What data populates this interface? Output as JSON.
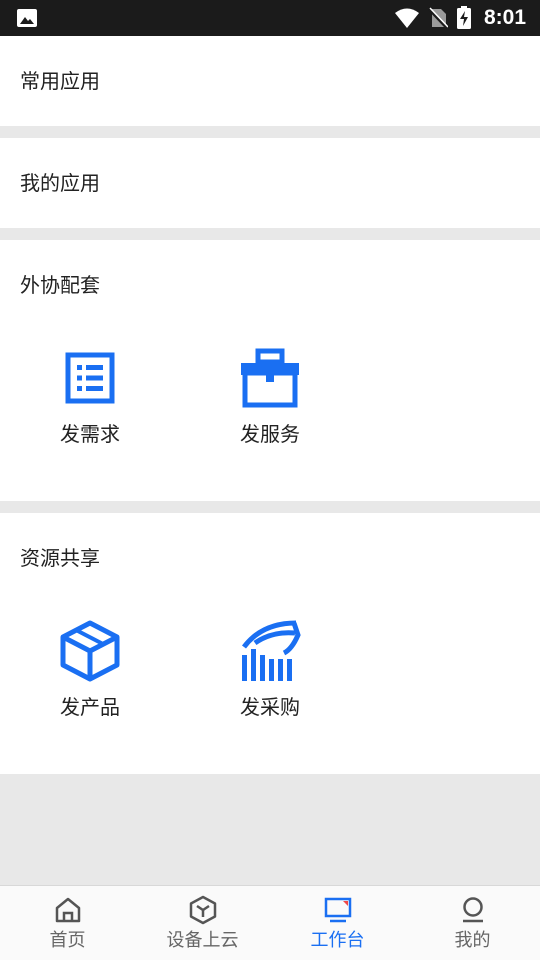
{
  "status_bar": {
    "time": "8:01",
    "icons": [
      "image-icon",
      "wifi-icon",
      "no-sim-icon",
      "battery-charging-icon"
    ]
  },
  "sections": {
    "common_apps": {
      "title": "常用应用"
    },
    "my_apps": {
      "title": "我的应用"
    },
    "outsourcing": {
      "title": "外协配套",
      "items": [
        {
          "label": "发需求",
          "icon": "list-document-icon"
        },
        {
          "label": "发服务",
          "icon": "toolbox-icon"
        }
      ]
    },
    "resource_sharing": {
      "title": "资源共享",
      "items": [
        {
          "label": "发产品",
          "icon": "box-cube-icon"
        },
        {
          "label": "发采购",
          "icon": "purchase-chart-icon"
        }
      ]
    }
  },
  "tabbar": {
    "items": [
      {
        "label": "首页",
        "icon": "home-icon",
        "active": false
      },
      {
        "label": "设备上云",
        "icon": "cube-cloud-icon",
        "active": false
      },
      {
        "label": "工作台",
        "icon": "monitor-icon",
        "active": true
      },
      {
        "label": "我的",
        "icon": "user-icon",
        "active": false
      }
    ]
  },
  "colors": {
    "accent": "#1a6ff2",
    "status_bar": "#1b1b1b",
    "background": "#e8e8e8",
    "text": "#222222",
    "tab_inactive": "#666666"
  }
}
